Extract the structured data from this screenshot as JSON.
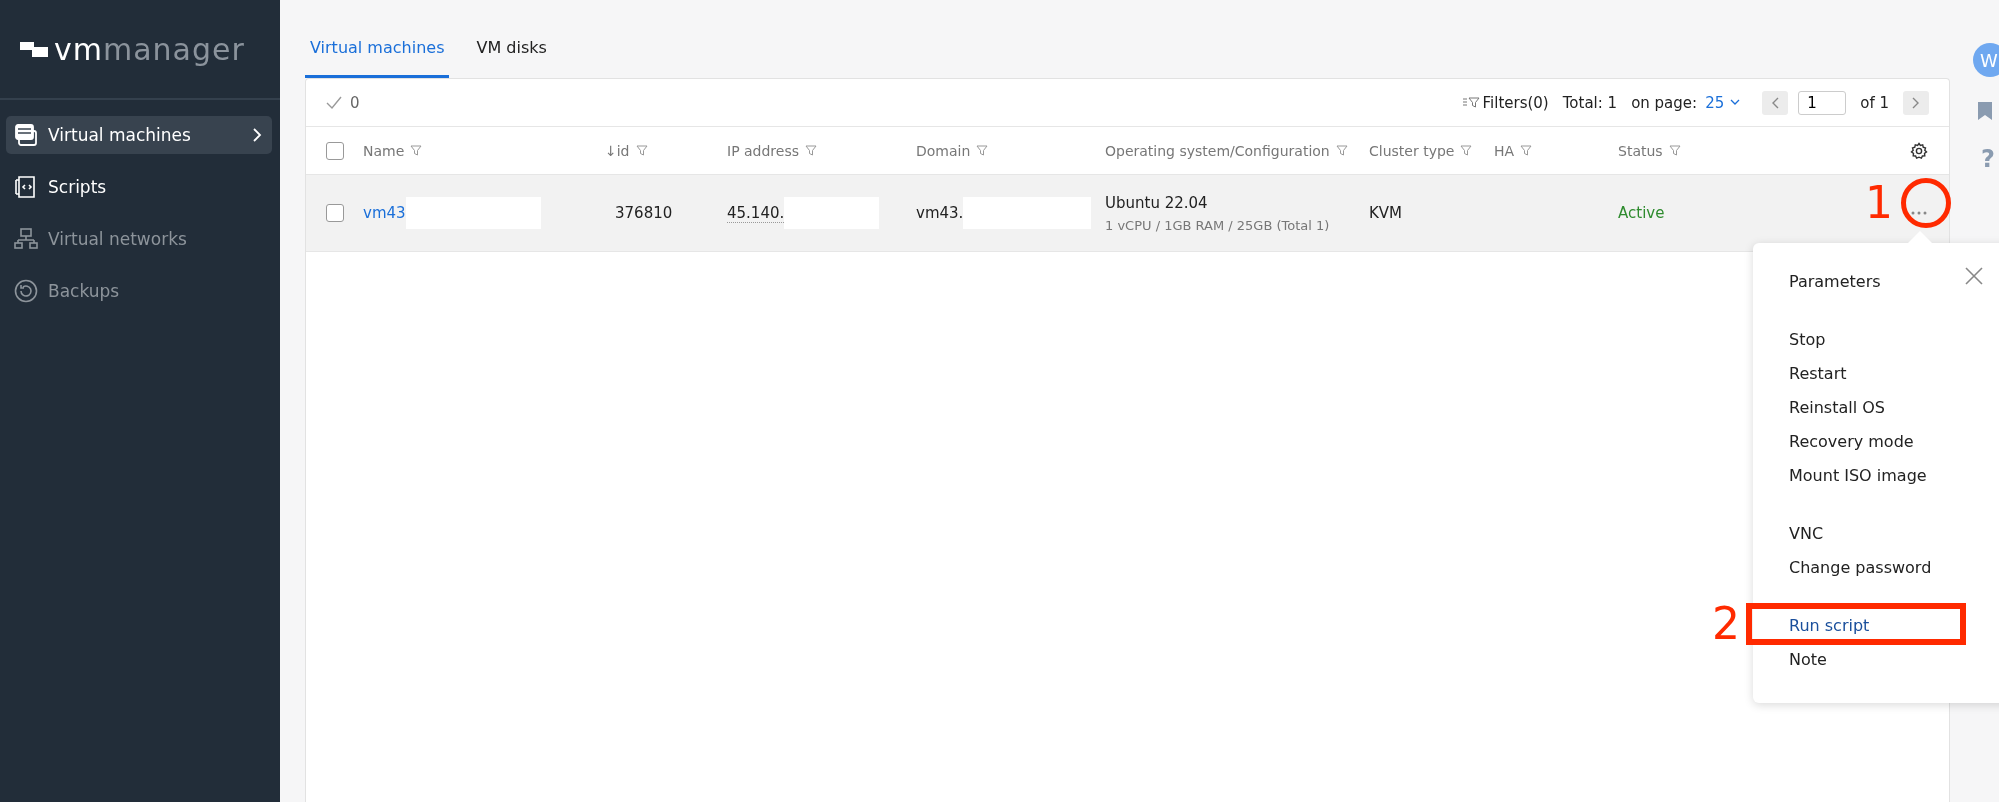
{
  "sidebar": {
    "logo": {
      "bold": "vm",
      "light": "manager"
    },
    "items": [
      {
        "label": "Virtual machines",
        "kind": "servers",
        "selected": true,
        "disabled": false,
        "submenu": true
      },
      {
        "label": "Scripts",
        "kind": "script",
        "selected": false,
        "disabled": false,
        "submenu": false
      },
      {
        "label": "Virtual networks",
        "kind": "network",
        "selected": false,
        "disabled": true,
        "submenu": false
      },
      {
        "label": "Backups",
        "kind": "backup",
        "selected": false,
        "disabled": true,
        "submenu": false
      }
    ]
  },
  "tabs": [
    {
      "label": "Virtual machines",
      "selected": true
    },
    {
      "label": "VM disks",
      "selected": false
    }
  ],
  "toolbar": {
    "selected_count": "0",
    "filters": "Filters(0)",
    "total": "Total: 1",
    "per_page_label": "on page:",
    "per_page": "25",
    "page": "1",
    "page_of": "of 1"
  },
  "table": {
    "all_checked": false,
    "columns": [
      {
        "label": "Name"
      },
      {
        "label": "↓id"
      },
      {
        "label": "IP address"
      },
      {
        "label": "Domain"
      },
      {
        "label": "Operating system/Configuration"
      },
      {
        "label": "Cluster type"
      },
      {
        "label": "HA"
      },
      {
        "label": "Status"
      }
    ],
    "rows": [
      {
        "checked": false,
        "name": "vm43",
        "id": "376810",
        "ip": "45.140.",
        "domain": "vm43.",
        "os": "Ubuntu 22.04",
        "config": "1 vCPU / 1GB RAM / 25GB (Total 1)",
        "cluster_type": "KVM",
        "status": "Active"
      }
    ]
  },
  "menu": {
    "groups": [
      {
        "items": [
          {
            "label": "Parameters",
            "selected": false
          }
        ]
      },
      {
        "items": [
          {
            "label": "Stop",
            "selected": false
          },
          {
            "label": "Restart",
            "selected": false
          },
          {
            "label": "Reinstall OS",
            "selected": false
          },
          {
            "label": "Recovery mode",
            "selected": false
          },
          {
            "label": "Mount ISO image",
            "selected": false
          }
        ]
      },
      {
        "items": [
          {
            "label": "VNC",
            "selected": false
          },
          {
            "label": "Change password",
            "selected": false
          }
        ]
      },
      {
        "items": [
          {
            "label": "Run script",
            "selected": true
          },
          {
            "label": "Note",
            "selected": false
          }
        ]
      }
    ]
  },
  "user": {
    "avatar": "W",
    "help": "?"
  },
  "annotations": [
    {
      "label": "1",
      "kind": "circle"
    },
    {
      "label": "2",
      "kind": "rectangle"
    }
  ]
}
